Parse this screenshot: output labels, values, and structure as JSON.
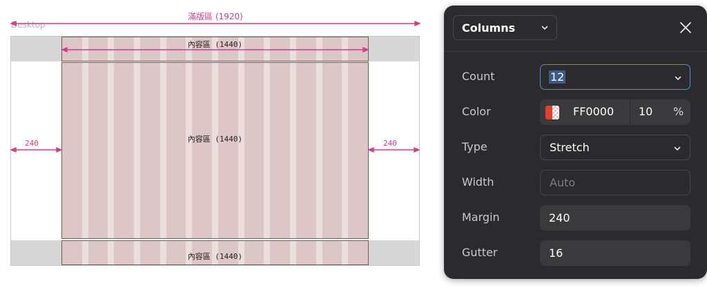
{
  "canvas": {
    "frame_label": "Desktop",
    "full_width_label": "滿版區 (1920)",
    "content_label": "內容區 (1440)",
    "margin_left_label": "240",
    "margin_right_label": "240"
  },
  "panel": {
    "mode_select": "Columns",
    "rows": {
      "count": {
        "label": "Count",
        "value": "12"
      },
      "color": {
        "label": "Color",
        "hex": "FF0000",
        "opacity": "10",
        "unit": "%"
      },
      "type": {
        "label": "Type",
        "value": "Stretch"
      },
      "width": {
        "label": "Width",
        "placeholder": "Auto"
      },
      "margin": {
        "label": "Margin",
        "value": "240"
      },
      "gutter": {
        "label": "Gutter",
        "value": "16"
      }
    }
  },
  "colors": {
    "annotation": "#d43d8a",
    "column_fill": "#ddc6c6",
    "panel_bg": "#2b2b2d",
    "focus": "#4d8fe0",
    "swatch": "#e5402f"
  },
  "icons": [
    "chevron-down-icon",
    "close-icon"
  ]
}
